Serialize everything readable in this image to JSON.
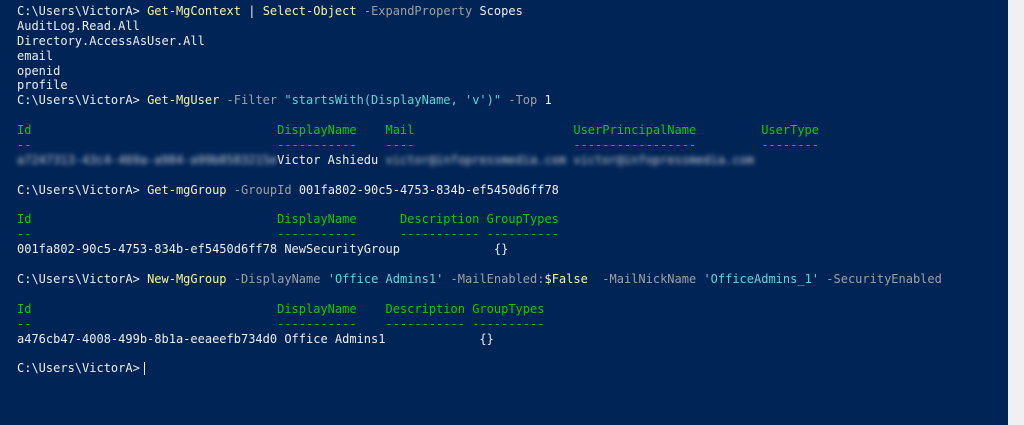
{
  "prompt": "C:\\Users\\VictorA>",
  "cmd1": {
    "cmdlet1": "Get-MgContext",
    "pipe": "|",
    "cmdlet2": "Select-Object",
    "param": "-ExpandProperty",
    "arg": "Scopes"
  },
  "scopes": [
    "AuditLog.Read.All",
    "Directory.AccessAsUser.All",
    "email",
    "openid",
    "profile"
  ],
  "cmd2": {
    "cmdlet": "Get-MgUser",
    "param1": "-Filter",
    "value1": "\"startsWith(DisplayName, 'v')\"",
    "param2": "-Top",
    "value2": "1"
  },
  "user_table": {
    "headers": [
      "Id",
      "DisplayName",
      "Mail",
      "UserPrincipalName",
      "UserType"
    ],
    "underlines": [
      "--",
      "-----------",
      "----",
      "-----------------",
      "--------"
    ],
    "row": [
      "a7247313-43c4-469a-a984-a99b8583215e",
      "Victor Ashiedu",
      "victor@infopressmedia.com",
      "victor@infopressmedia.com",
      ""
    ]
  },
  "cmd3": {
    "cmdlet": "Get-mgGroup",
    "param": "-GroupId",
    "value": "001fa802-90c5-4753-834b-ef5450d6ff78"
  },
  "group_table1": {
    "headers": [
      "Id",
      "DisplayName",
      "Description",
      "GroupTypes"
    ],
    "underlines": [
      "--",
      "-----------",
      "-----------",
      "----------"
    ],
    "row": [
      "001fa802-90c5-4753-834b-ef5450d6ff78",
      "NewSecurityGroup",
      "",
      "{}"
    ]
  },
  "cmd4": {
    "cmdlet": "New-MgGroup",
    "param1": "-DisplayName",
    "value1": "'Office Admins1'",
    "param2": "-MailEnabled:",
    "value2": "$False",
    "param3": "-MailNickName",
    "value3": "'OfficeAdmins_1'",
    "param4": "-SecurityEnabled"
  },
  "group_table2": {
    "headers": [
      "Id",
      "DisplayName",
      "Description",
      "GroupTypes"
    ],
    "underlines": [
      "--",
      "-----------",
      "-----------",
      "----------"
    ],
    "row": [
      "a476cb47-4008-499b-8b1a-eeaeefb734d0",
      "Office Admins1",
      "",
      "{}"
    ]
  },
  "colors": {
    "background": "#012456",
    "text": "#eeedf0",
    "cmdlet": "#f9f1a5",
    "parameter": "#a0a0a0",
    "string": "#61d6d6",
    "header": "#16c60c"
  }
}
